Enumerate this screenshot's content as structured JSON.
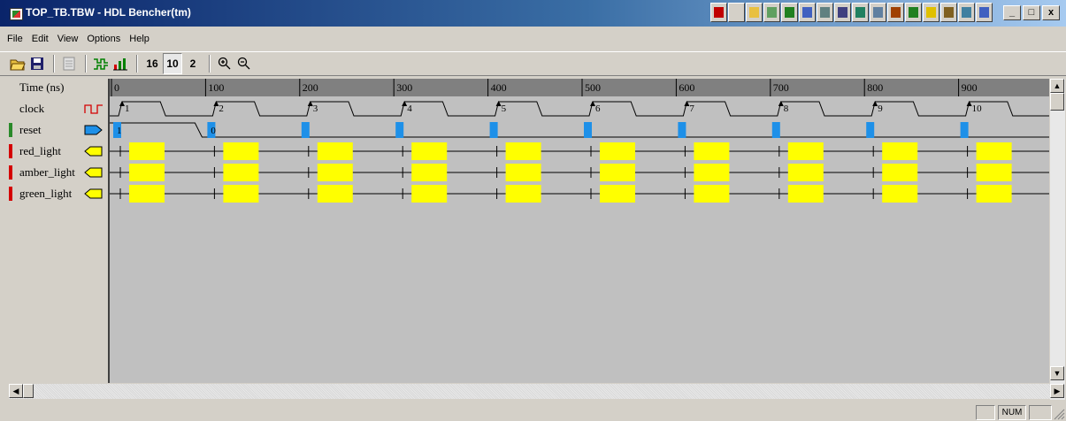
{
  "window": {
    "title": "TOP_TB.TBW - HDL Bencher(tm)"
  },
  "tray_icons": [
    "app-block-icon",
    "new-doc-icon",
    "open-folder-icon",
    "w-letter-icon",
    "x-letter-icon",
    "window-icon",
    "find-icon",
    "chip-icon",
    "n-letter-icon",
    "wizard-icon",
    "bug-icon",
    "globe-icon",
    "lightning-icon",
    "tool-icon",
    "image-icon",
    "help-icon"
  ],
  "caption_buttons": {
    "minimize": "_",
    "maximize": "□",
    "close": "x"
  },
  "menu": [
    "File",
    "Edit",
    "View",
    "Options",
    "Help"
  ],
  "toolbar": {
    "radix_16": "16",
    "radix_10": "10",
    "radix_2": "2"
  },
  "time_header": {
    "label": "Time (ns)",
    "ticks": [
      "0",
      "100",
      "200",
      "300",
      "400",
      "500",
      "600",
      "700",
      "800",
      "900"
    ]
  },
  "signals": [
    {
      "name": "clock",
      "kind": "clock",
      "marker": "none"
    },
    {
      "name": "reset",
      "kind": "input",
      "marker": "#2a8a2a"
    },
    {
      "name": "red_light",
      "kind": "output",
      "marker": "#d40000"
    },
    {
      "name": "amber_light",
      "kind": "output",
      "marker": "#d40000"
    },
    {
      "name": "green_light",
      "kind": "output",
      "marker": "#d40000"
    }
  ],
  "clock_edges": [
    "1",
    "2",
    "3",
    "4",
    "5",
    "6",
    "7",
    "8",
    "9",
    "10"
  ],
  "reset_values": [
    "1",
    "0"
  ],
  "colors": {
    "input_marker": "#1e90e8",
    "output_box": "#ffff00",
    "wave_bg": "#c0c0c0",
    "header_bg": "#808080"
  },
  "status": {
    "num": "NUM"
  }
}
